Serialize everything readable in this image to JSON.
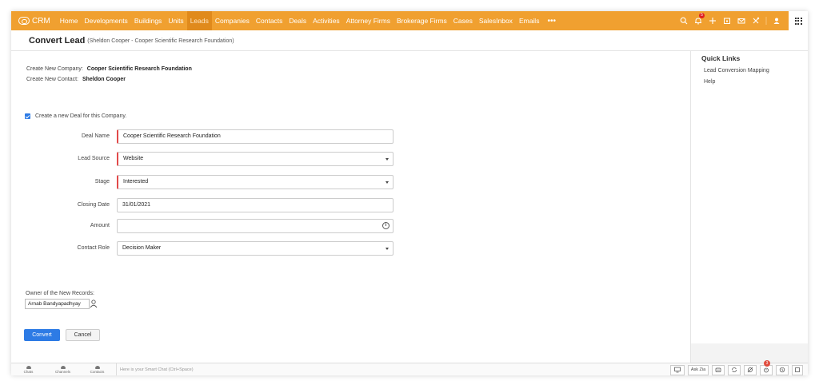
{
  "topnav": {
    "brand": "CRM",
    "items": [
      {
        "label": "Home",
        "active": false
      },
      {
        "label": "Developments",
        "active": false
      },
      {
        "label": "Buildings",
        "active": false
      },
      {
        "label": "Units",
        "active": false
      },
      {
        "label": "Leads",
        "active": true
      },
      {
        "label": "Companies",
        "active": false
      },
      {
        "label": "Contacts",
        "active": false
      },
      {
        "label": "Deals",
        "active": false
      },
      {
        "label": "Activities",
        "active": false
      },
      {
        "label": "Attorney Firms",
        "active": false
      },
      {
        "label": "Brokerage Firms",
        "active": false
      },
      {
        "label": "Cases",
        "active": false
      },
      {
        "label": "SalesInbox",
        "active": false
      },
      {
        "label": "Emails",
        "active": false
      }
    ],
    "more": "•••",
    "notification_count": "5",
    "accent_color": "#f0a030"
  },
  "page": {
    "title": "Convert Lead",
    "subtitle": "(Sheldon Cooper - Cooper Scientific Research Foundation)"
  },
  "info": {
    "company_label": "Create New Company:",
    "company_value": "Cooper Scientific Research Foundation",
    "contact_label": "Create New Contact:",
    "contact_value": "Sheldon Cooper"
  },
  "deal_checkbox": {
    "label": "Create a new Deal for this Company.",
    "checked": true
  },
  "form": {
    "deal_name": {
      "label": "Deal Name",
      "value": "Cooper Scientific Research Foundation"
    },
    "lead_source": {
      "label": "Lead Source",
      "value": "Website"
    },
    "stage": {
      "label": "Stage",
      "value": "Interested"
    },
    "closing_date": {
      "label": "Closing Date",
      "value": "31/01/2021"
    },
    "amount": {
      "label": "Amount",
      "value": ""
    },
    "contact_role": {
      "label": "Contact Role",
      "value": "Decision Maker"
    }
  },
  "owner": {
    "label": "Owner of the New Records:",
    "value": "Arnab Bandyapadhyay"
  },
  "buttons": {
    "convert": "Convert",
    "cancel": "Cancel"
  },
  "quick_links": {
    "title": "Quick Links",
    "items": [
      "Lead Conversion Mapping",
      "Help"
    ]
  },
  "footer": {
    "items": [
      "Chats",
      "Channels",
      "Contacts"
    ],
    "smart_chat_placeholder": "Here is your Smart Chat (Ctrl+Space)",
    "ask_zia": "Ask Zia",
    "reminder_count": "3"
  }
}
